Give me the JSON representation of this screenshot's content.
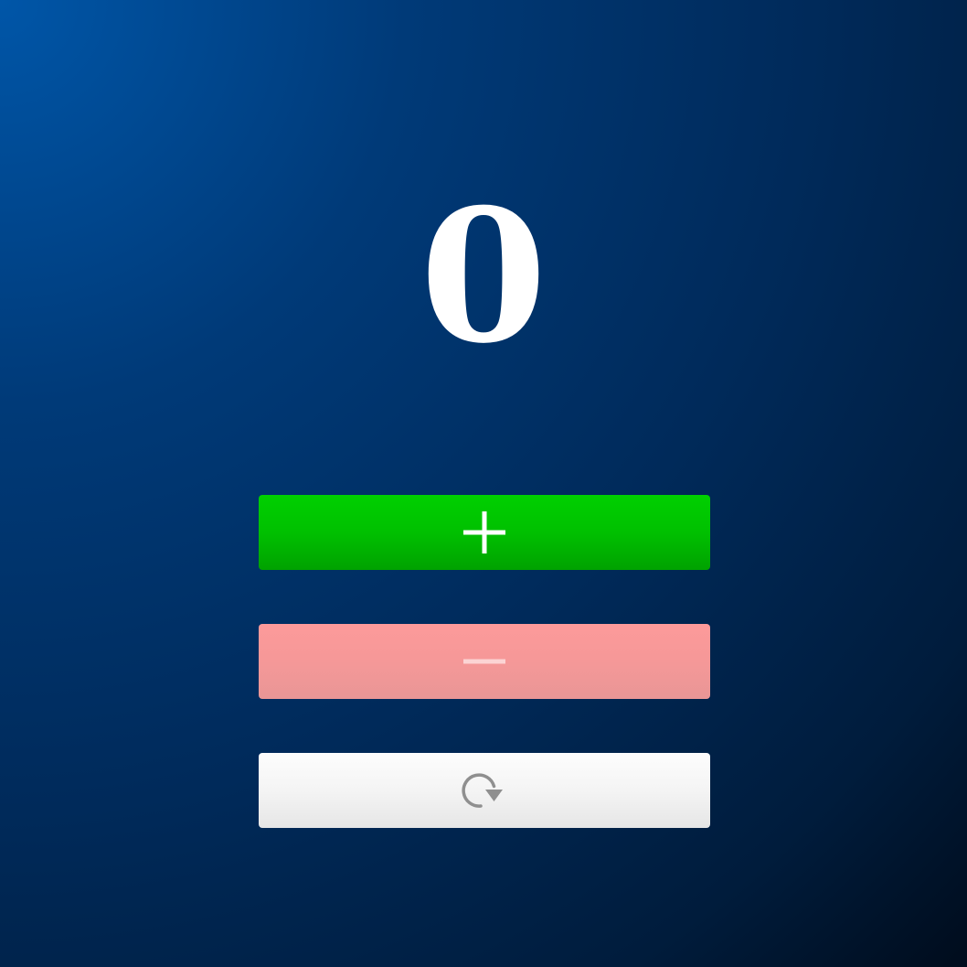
{
  "counter": {
    "value": "0"
  },
  "buttons": {
    "increment": {
      "icon": "plus-icon",
      "color": "#00c000"
    },
    "decrement": {
      "icon": "minus-icon",
      "color": "#f59898",
      "disabled": true
    },
    "reset": {
      "icon": "reset-icon",
      "color": "#f4f4f4"
    }
  },
  "colors": {
    "background_start": "#0056a8",
    "background_end": "#000d1e",
    "text": "#ffffff"
  }
}
